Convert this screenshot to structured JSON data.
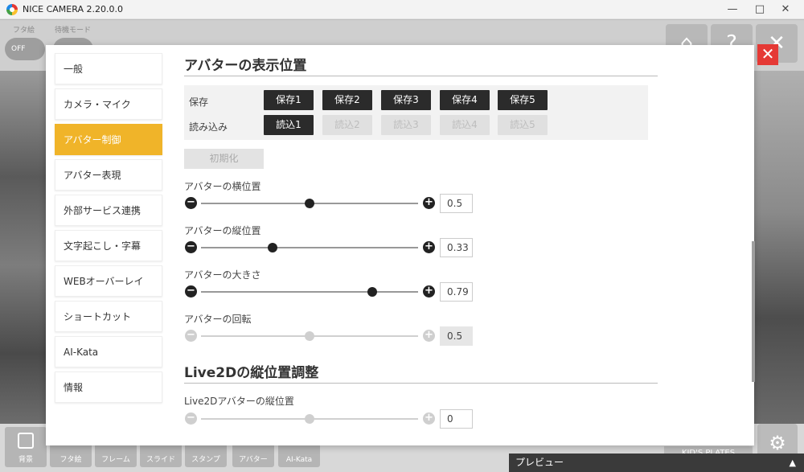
{
  "window": {
    "title": "NICE CAMERA 2.20.0.0",
    "minimize": "—",
    "maximize": "□",
    "close": "✕"
  },
  "background": {
    "toggle1_label": "フタ絵",
    "toggle1_state": "OFF",
    "toggle2_label": "待機モード",
    "bottom_tools": [
      "背景",
      "フタ絵",
      "フレーム",
      "スライド",
      "スタンプ",
      "アバター",
      "AI-Kata"
    ],
    "badge": "KID'S PLATES",
    "preview_label": "プレビュー"
  },
  "sidebar": {
    "items": [
      {
        "label": "一般"
      },
      {
        "label": "カメラ・マイク"
      },
      {
        "label": "アバター制御",
        "active": true
      },
      {
        "label": "アバター表現"
      },
      {
        "label": "外部サービス連携"
      },
      {
        "label": "文字起こし・字幕"
      },
      {
        "label": "WEBオーバーレイ"
      },
      {
        "label": "ショートカット"
      },
      {
        "label": "AI-Kata"
      },
      {
        "label": "情報"
      }
    ]
  },
  "section1": {
    "title": "アバターの表示位置",
    "save_label": "保存",
    "load_label": "読み込み",
    "save_slots": [
      "保存1",
      "保存2",
      "保存3",
      "保存4",
      "保存5"
    ],
    "load_slots": [
      "読込1",
      "読込2",
      "読込3",
      "読込4",
      "読込5"
    ],
    "reset_label": "初期化",
    "sliders": [
      {
        "label": "アバターの横位置",
        "value": "0.5",
        "fraction": 0.5,
        "enabled": true
      },
      {
        "label": "アバターの縦位置",
        "value": "0.33",
        "fraction": 0.33,
        "enabled": true
      },
      {
        "label": "アバターの大きさ",
        "value": "0.79",
        "fraction": 0.79,
        "enabled": true
      },
      {
        "label": "アバターの回転",
        "value": "0.5",
        "fraction": 0.5,
        "enabled": false
      }
    ]
  },
  "section2": {
    "title": "Live2Dの縦位置調整",
    "sliders": [
      {
        "label": "Live2Dアバターの縦位置",
        "value": "0",
        "fraction": 0.5,
        "enabled": false
      }
    ]
  }
}
